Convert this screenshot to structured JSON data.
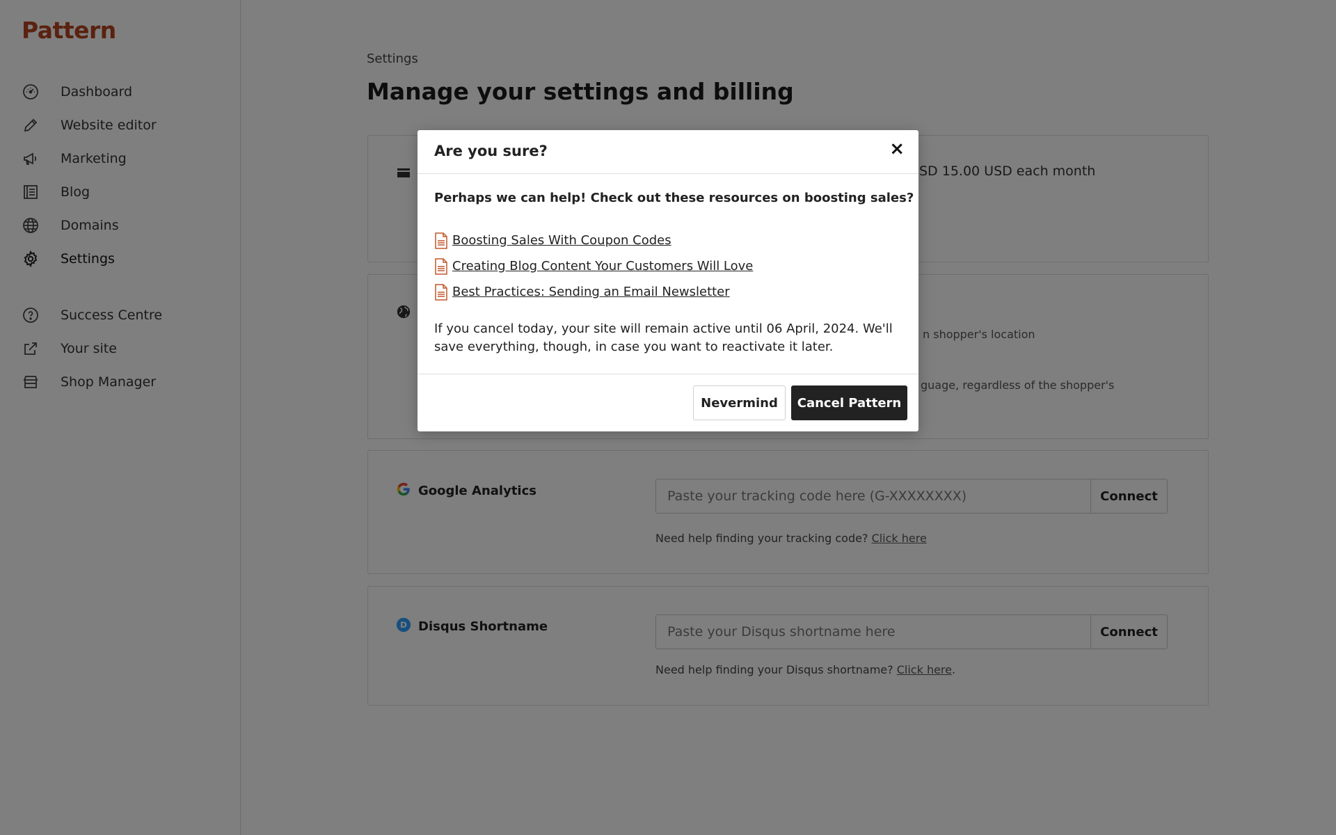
{
  "app": {
    "logo": "Pattern",
    "brand_color": "#b5441f"
  },
  "sidebar": {
    "items": [
      {
        "label": "Dashboard",
        "icon": "gauge-icon"
      },
      {
        "label": "Website editor",
        "icon": "pencil-icon"
      },
      {
        "label": "Marketing",
        "icon": "megaphone-icon"
      },
      {
        "label": "Blog",
        "icon": "list-icon"
      },
      {
        "label": "Domains",
        "icon": "globe-icon"
      },
      {
        "label": "Settings",
        "icon": "gear-icon",
        "active": true
      },
      {
        "label": "Success Centre",
        "icon": "question-icon"
      },
      {
        "label": "Your site",
        "icon": "external-link-icon"
      },
      {
        "label": "Shop Manager",
        "icon": "store-icon"
      }
    ]
  },
  "main": {
    "breadcrumb": "Settings",
    "title": "Manage your settings and billing",
    "billing": {
      "price_text": "SD 15.00 USD each month"
    },
    "language": {
      "option1_text": "n shopper's location",
      "option2_text": "guage, regardless of the shopper's"
    },
    "google_analytics": {
      "label": "Google Analytics",
      "placeholder": "Paste your tracking code here (G-XXXXXXXX)",
      "button": "Connect",
      "help": "Need help finding your tracking code?",
      "help_link": "Click here"
    },
    "disqus": {
      "label": "Disqus Shortname",
      "placeholder": "Paste your Disqus shortname here",
      "button": "Connect",
      "help": "Need help finding your Disqus shortname?",
      "help_link": "Click here",
      "help_suffix": "."
    }
  },
  "modal": {
    "title": "Are you sure?",
    "close": "×",
    "lead": "Perhaps we can help! Check out these resources on boosting sales?",
    "resources": [
      {
        "label": " Boosting Sales With Coupon Codes"
      },
      {
        "label": " Creating Blog Content Your Customers Will Love"
      },
      {
        "label": " Best Practices: Sending an Email Newsletter"
      }
    ],
    "note": "If you cancel today, your site will remain active until 06 April, 2024. We'll save everything, though, in case you want to reactivate it later.",
    "nevermind": "Nevermind",
    "confirm": "Cancel Pattern"
  }
}
